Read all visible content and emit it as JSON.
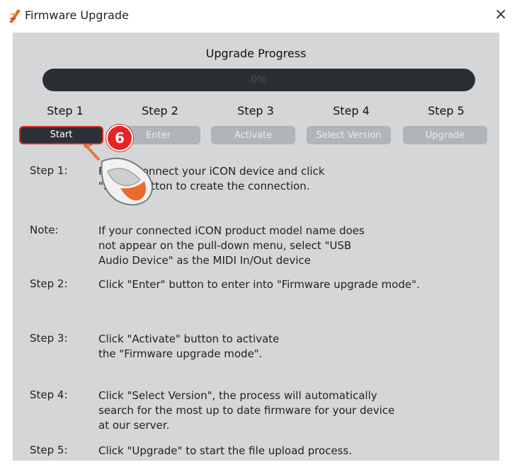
{
  "window": {
    "title": "Firmware Upgrade",
    "close_glyph": "×"
  },
  "upgrade": {
    "heading": "Upgrade Progress",
    "progress_text": "0%",
    "progress_value": 0
  },
  "steps": [
    {
      "label": "Step 1",
      "button": "Start"
    },
    {
      "label": "Step 2",
      "button": "Enter"
    },
    {
      "label": "Step 3",
      "button": "Activate"
    },
    {
      "label": "Step 4",
      "button": "Select Version"
    },
    {
      "label": "Step 5",
      "button": "Upgrade"
    }
  ],
  "instructions": [
    {
      "label": "Step 1:",
      "lines": [
        "Please connect your iCON device and click",
        "\"Start\" button to create the connection."
      ]
    },
    {
      "label": "Note:",
      "lines": [
        "If your connected iCON product model name does",
        "not appear on the pull-down menu, select \"USB",
        "Audio Device\" as the MIDI In/Out device"
      ]
    },
    {
      "label": "Step 2:",
      "lines": [
        "Click \"Enter\" button to enter into \"Firmware upgrade mode\"."
      ]
    },
    {
      "label": "Step 3:",
      "lines": [
        "Click \"Activate\" button to activate",
        "the \"Firmware upgrade mode\"."
      ]
    },
    {
      "label": "Step 4:",
      "lines": [
        "Click \"Select Version\", the process will automatically",
        "search for the most up to date firmware for your device",
        "at our server."
      ]
    },
    {
      "label": "Step 5:",
      "lines": [
        "Click \"Upgrade\" to start the file upload process."
      ]
    }
  ],
  "annotation": {
    "number": "6"
  },
  "colors": {
    "accent": "#e52424",
    "panel": "#d5d6d7",
    "progress_track": "#2b2f35"
  },
  "icons": {
    "app": "app-logo-icon",
    "pointer": "mouse-pointer-icon"
  }
}
